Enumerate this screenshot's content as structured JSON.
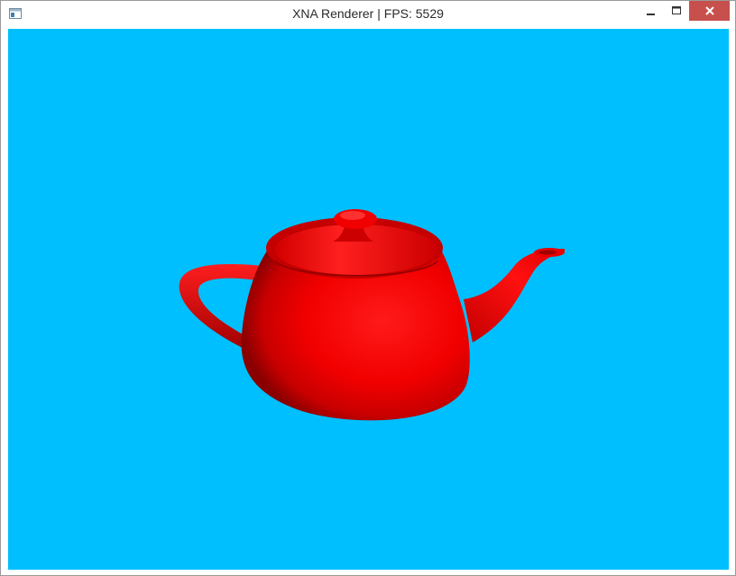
{
  "window": {
    "title": "XNA Renderer | FPS: 5529",
    "icons": {
      "app": "app-window-icon",
      "minimize": "minimize-icon",
      "maximize": "maximize-icon",
      "close": "close-icon"
    }
  },
  "scene": {
    "background_color": "#00bfff",
    "object": "teapot",
    "object_color": "#ff0000"
  }
}
